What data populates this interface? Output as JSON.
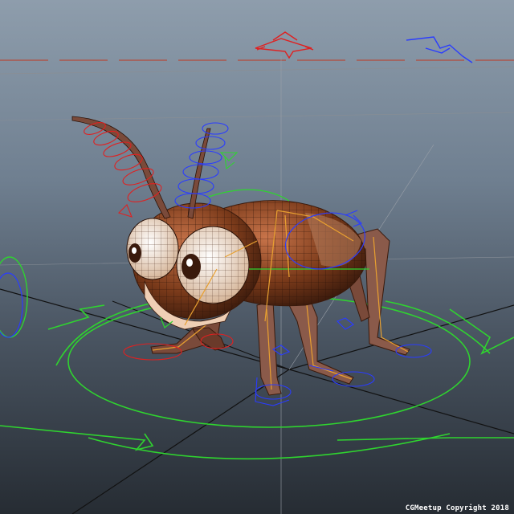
{
  "viewport": {
    "background_top": "#8e9dac",
    "background_bottom": "#262c33",
    "subject": "rigged cricket character in wireframe shaded mode",
    "overlay_text": "CGMeetup Copyright 2018"
  },
  "colors": {
    "control_green": "#2fd42f",
    "control_blue": "#2a3cff",
    "control_red": "#e02020",
    "joint_orange": "#e8a030",
    "body_brown": "#7a3a1a",
    "grid_black": "#111111"
  },
  "icons": [
    "translate-manipulator-icon",
    "rotate-manipulator-icon",
    "main-control-circle"
  ]
}
